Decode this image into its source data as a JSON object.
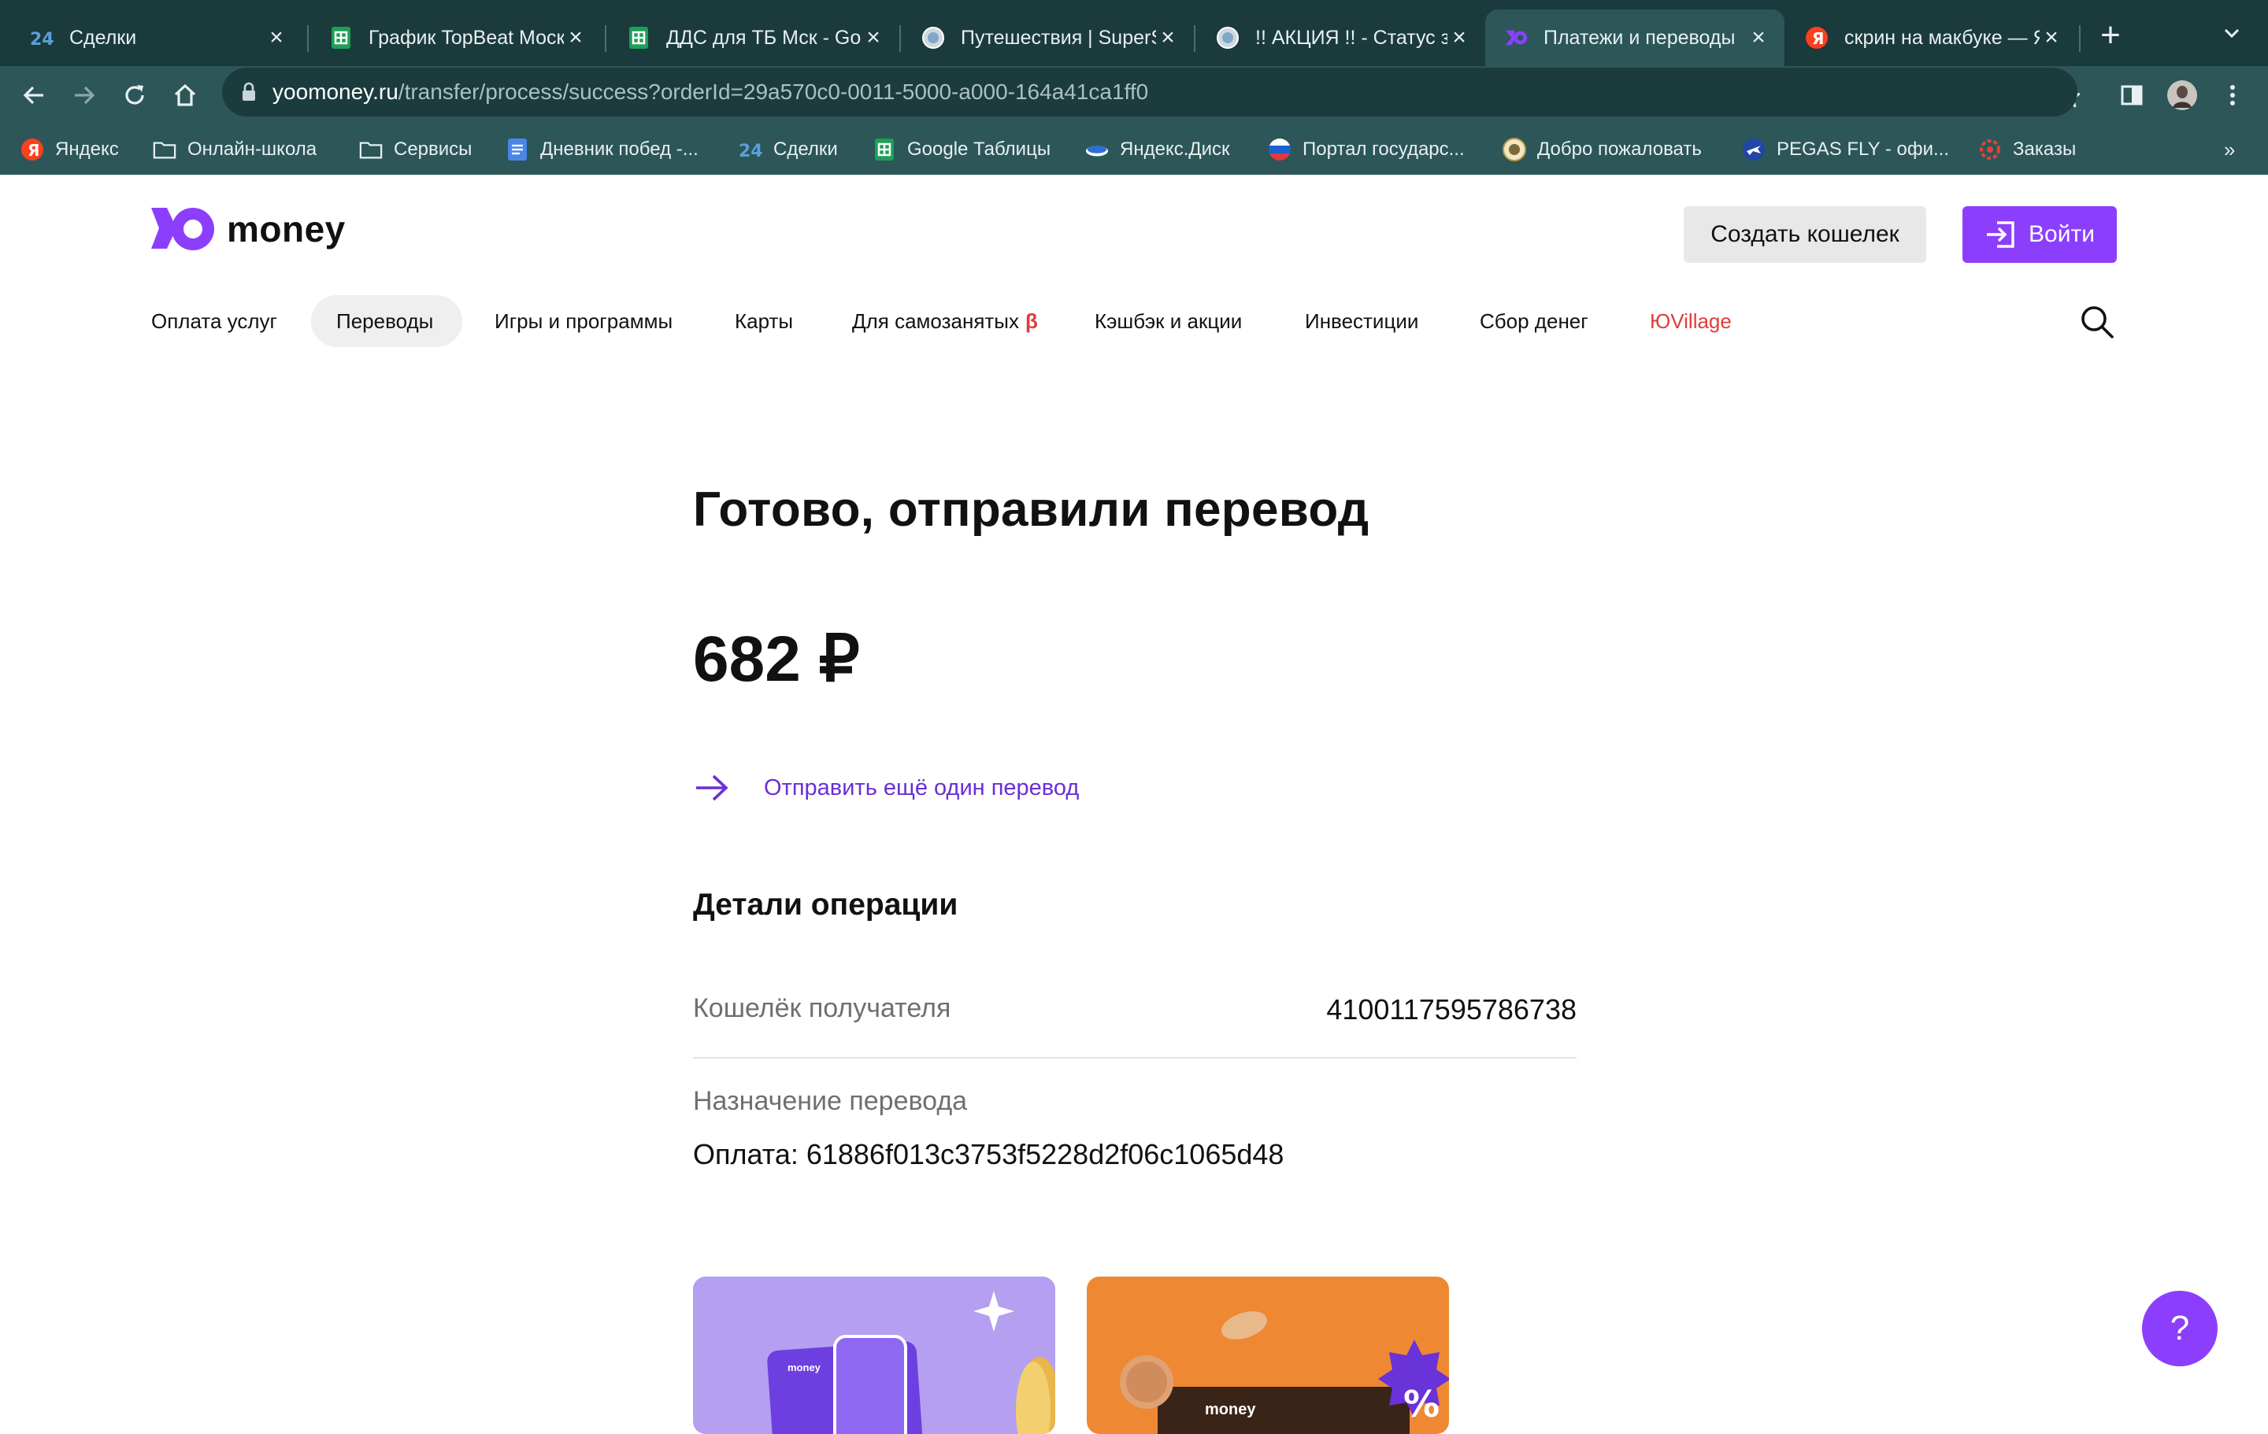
{
  "browser": {
    "tabs": [
      {
        "title": "Сделки",
        "favicon": "bitrix24-icon",
        "active": false
      },
      {
        "title": "График TopBeat Москва",
        "favicon": "google-sheets-icon",
        "active": false
      },
      {
        "title": "ДДС для ТБ Мск - Google Таблицы",
        "favicon": "google-sheets-icon",
        "active": false
      },
      {
        "title": "Путешествия | SuperSale",
        "favicon": "site-globe-icon",
        "active": false
      },
      {
        "title": "!! АКЦИЯ !! - Статус заказа",
        "favicon": "site-globe-icon",
        "active": false
      },
      {
        "title": "Платежи и переводы",
        "favicon": "yoomoney-icon",
        "active": true
      },
      {
        "title": "скрин на макбуке — Яндекс",
        "favicon": "yandex-icon",
        "active": false
      }
    ],
    "new_tab": "+",
    "address": {
      "host": "yoomoney.ru",
      "path": "/transfer/process/success?orderId=29a570c0-0011-5000-a000-164a41ca1ff0"
    },
    "bookmarks": [
      {
        "label": "Яндекс",
        "icon": "yandex-icon"
      },
      {
        "label": "Онлайн-школа",
        "icon": "folder-icon"
      },
      {
        "label": "Сервисы",
        "icon": "folder-icon"
      },
      {
        "label": "Дневник побед -...",
        "icon": "google-docs-icon"
      },
      {
        "label": "Сделки",
        "icon": "bitrix24-icon"
      },
      {
        "label": "Google Таблицы",
        "icon": "google-sheets-icon"
      },
      {
        "label": "Яндекс.Диск",
        "icon": "yandex-disk-icon"
      },
      {
        "label": "Портал государс...",
        "icon": "gosuslugi-icon"
      },
      {
        "label": "Добро пожаловать",
        "icon": "emblem-icon"
      },
      {
        "label": "PEGAS FLY - офи...",
        "icon": "plane-icon"
      },
      {
        "label": "Заказы",
        "icon": "orders-icon"
      }
    ],
    "more": "»"
  },
  "site": {
    "logo_text": "money",
    "create_wallet": "Создать кошелек",
    "login": "Войти",
    "nav": [
      "Оплата услуг",
      "Переводы",
      "Игры и программы",
      "Карты",
      "Для самозанятых",
      "Кэшбэк и акции",
      "Инвестиции",
      "Сбор денег",
      "ЮVillage"
    ],
    "nav_beta": "β",
    "active_nav": "Переводы"
  },
  "main": {
    "title": "Готово, отправили перевод",
    "amount": "682 ₽",
    "send_again": "Отправить ещё один перевод",
    "details_heading": "Детали операции",
    "recipient_label": "Кошелёк получателя",
    "recipient_value": "4100117595786738",
    "purpose_label": "Назначение перевода",
    "purpose_value": "Оплата: 61886f013c3753f5228d2f06c1065d48",
    "promo_card_brand": "money",
    "help": "?"
  },
  "colors": {
    "brand": "#8b3ffd",
    "link": "#6a2fd6",
    "browser_frame": "#1b3a3c",
    "browser_toolbar": "#2c5658",
    "accent_red": "#e23b3b"
  }
}
